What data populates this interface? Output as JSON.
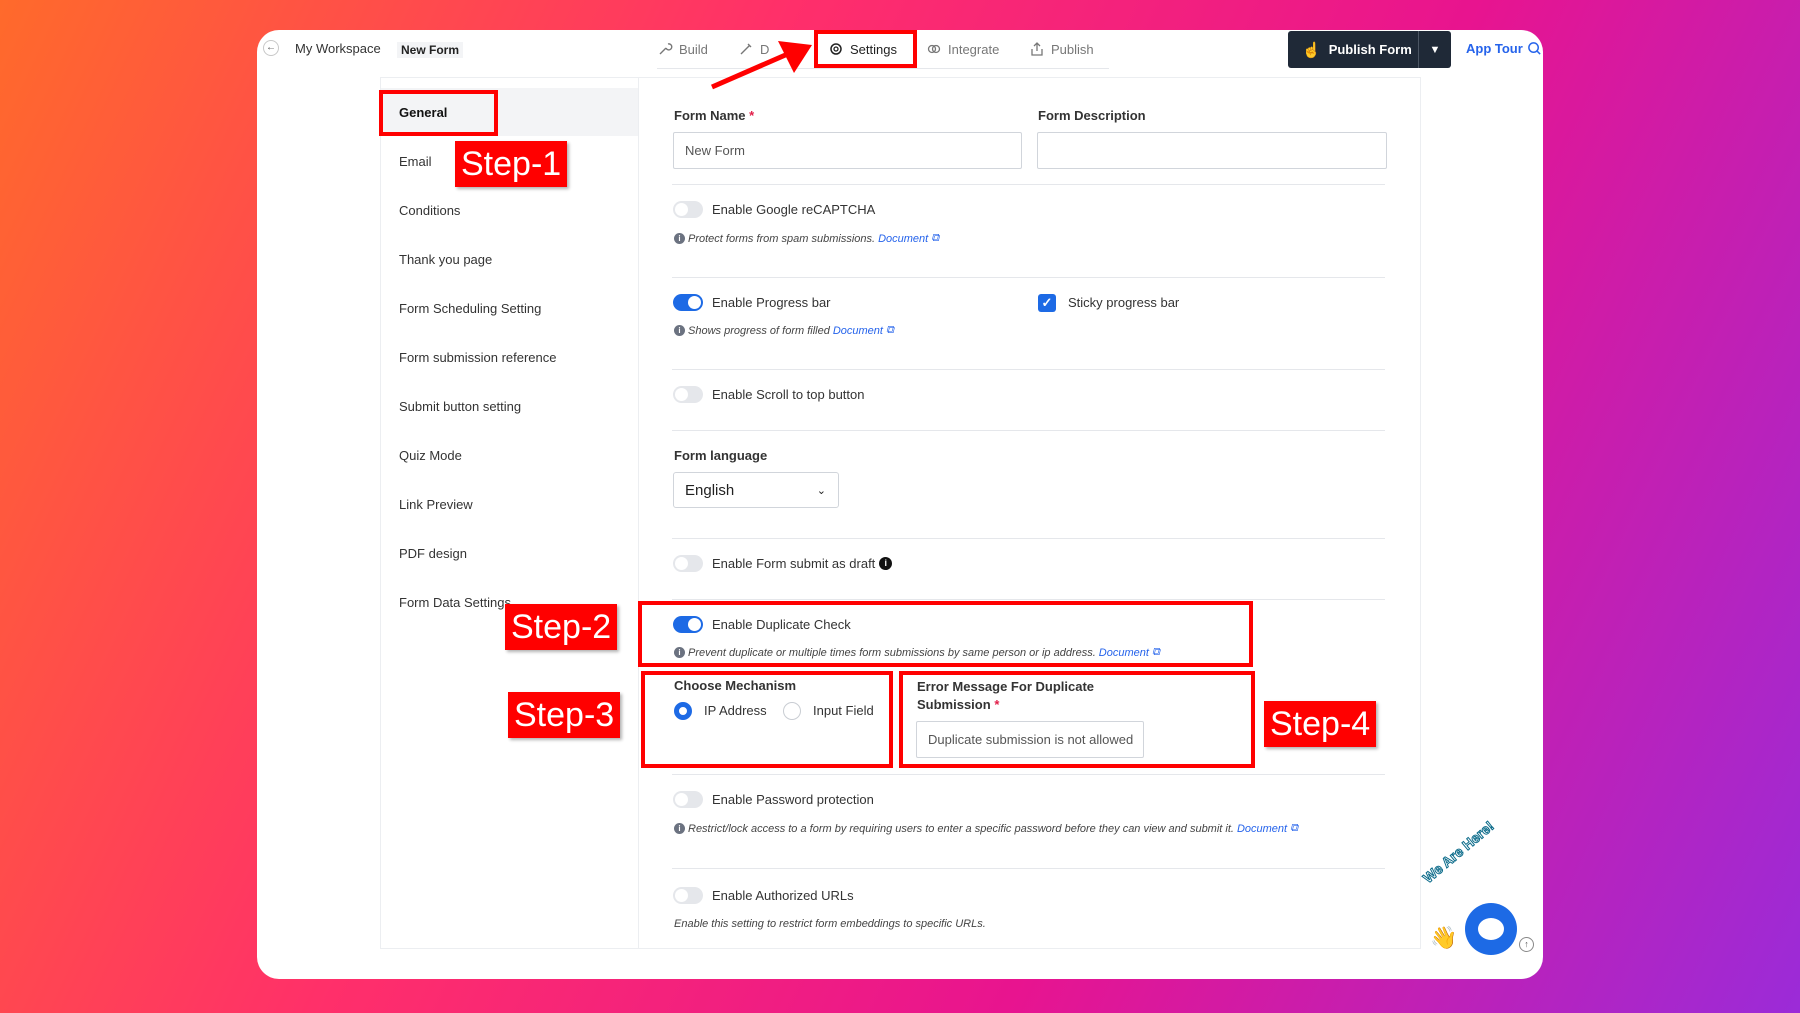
{
  "header": {
    "back_icon": "arrow-left-icon",
    "workspace": "My Workspace",
    "form_name": "New Form",
    "tabs": [
      {
        "label": "Build",
        "icon": "build-icon"
      },
      {
        "label": "D",
        "icon": "design-icon"
      },
      {
        "label": "Settings",
        "icon": "settings-icon"
      },
      {
        "label": "Integrate",
        "icon": "integrate-icon"
      },
      {
        "label": "Publish",
        "icon": "publish-icon"
      }
    ],
    "publish_button": "Publish Form",
    "app_tour": "App Tour"
  },
  "sidebar": {
    "items": [
      {
        "label": "General",
        "active": true
      },
      {
        "label": "Email"
      },
      {
        "label": "Conditions"
      },
      {
        "label": "Thank you page"
      },
      {
        "label": "Form Scheduling Setting"
      },
      {
        "label": "Form submission reference"
      },
      {
        "label": "Submit button setting"
      },
      {
        "label": "Quiz Mode"
      },
      {
        "label": "Link Preview"
      },
      {
        "label": "PDF design"
      },
      {
        "label": "Form Data Settings"
      }
    ]
  },
  "main": {
    "form_name_label": "Form Name",
    "required_mark": "*",
    "form_name_value": "New Form",
    "form_description_label": "Form Description",
    "form_description_value": "",
    "recaptcha": {
      "label": "Enable Google reCAPTCHA",
      "on": false,
      "help": "Protect forms from spam submissions.",
      "doc": "Document"
    },
    "progress": {
      "label": "Enable Progress bar",
      "on": true,
      "help": "Shows progress of form filled",
      "doc": "Document",
      "sticky_label": "Sticky progress bar",
      "sticky_checked": true
    },
    "scroll_top": {
      "label": "Enable Scroll to top button",
      "on": false
    },
    "language": {
      "label": "Form language",
      "value": "English"
    },
    "draft": {
      "label": "Enable Form submit as draft",
      "on": false
    },
    "duplicate": {
      "label": "Enable Duplicate Check",
      "on": true,
      "help": "Prevent duplicate or multiple times form submissions by same person or ip address.",
      "doc": "Document"
    },
    "mechanism": {
      "label": "Choose Mechanism",
      "options": [
        "IP Address",
        "Input Field"
      ],
      "selected": "IP Address"
    },
    "error_message": {
      "label": "Error Message For Duplicate Submission",
      "value": "Duplicate submission is not allowed"
    },
    "password": {
      "label": "Enable Password protection",
      "on": false,
      "help": "Restrict/lock access to a form by requiring users to enter a specific password before they can view and submit it.",
      "doc": "Document"
    },
    "authorized_urls": {
      "label": "Enable Authorized URLs",
      "on": false,
      "help": "Enable this setting to restrict form embeddings to specific URLs."
    }
  },
  "annotations": {
    "step1": "Step-1",
    "step2": "Step-2",
    "step3": "Step-3",
    "step4": "Step-4",
    "color": "#ff0000"
  },
  "chat_widget": {
    "text": "We Are Here!",
    "icon": "chat-icon"
  }
}
